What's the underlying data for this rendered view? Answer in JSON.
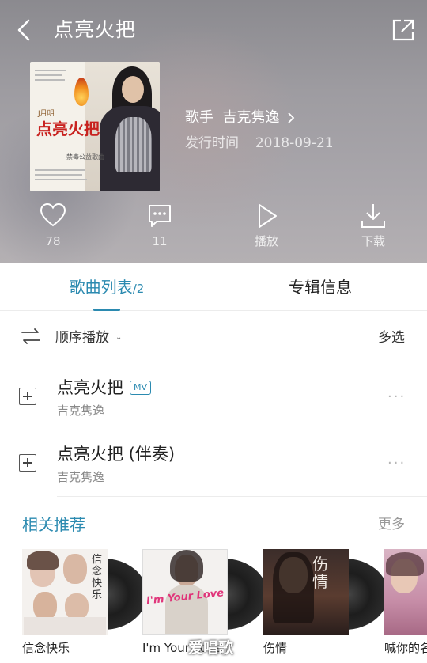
{
  "header": {
    "title": "点亮火把",
    "artist_row": "歌手  吉克隽逸",
    "release_label": "发行时间",
    "release_date": "2018-09-21",
    "cover": {
      "brand": "J月明",
      "album_title": "点亮火把",
      "subtitle": "禁毒公益歌曲"
    }
  },
  "actions": [
    {
      "icon": "heart-icon",
      "label": "78"
    },
    {
      "icon": "comment-icon",
      "label": "11"
    },
    {
      "icon": "play-icon",
      "label": "播放"
    },
    {
      "icon": "download-icon",
      "label": "下载"
    }
  ],
  "tabs": {
    "songs_label": "歌曲列表",
    "songs_count": "/2",
    "album_label": "专辑信息"
  },
  "toolbar": {
    "order_label": "顺序播放",
    "multi_select": "多选"
  },
  "songs": [
    {
      "title": "点亮火把",
      "badge": "MV",
      "artist": "吉克隽逸"
    },
    {
      "title": "点亮火把 (伴奏)",
      "badge": "",
      "artist": "吉克隽逸"
    }
  ],
  "related": {
    "title": "相关推荐",
    "more": "更多",
    "items": [
      {
        "name": "信念快乐",
        "cover_text": "信念快乐"
      },
      {
        "name": "I'm Your Love",
        "cover_text": "I'm Your Love"
      },
      {
        "name": "伤情",
        "cover_text": "伤情"
      },
      {
        "name": "喊你的名字",
        "cover_text": ""
      }
    ]
  },
  "watermark": "爱唱歌",
  "colors": {
    "accent": "#2b8ab0",
    "header_bg": "#9e9ca1"
  }
}
